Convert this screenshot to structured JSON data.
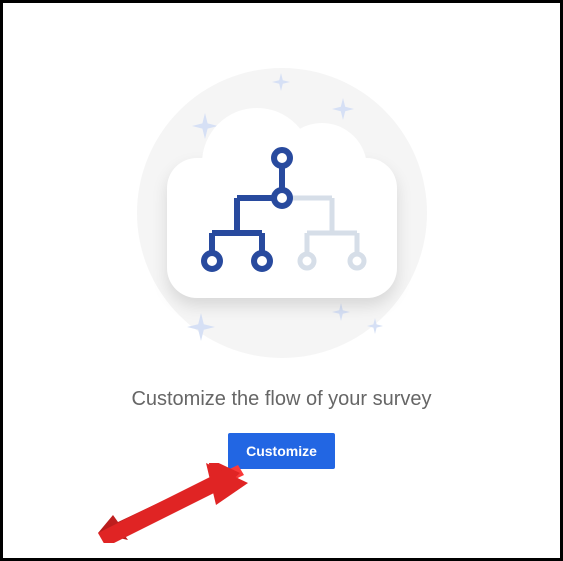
{
  "heading": "Customize the flow of your survey",
  "button_label": "Customize",
  "colors": {
    "accent": "#2266e3",
    "heading": "#666666",
    "sparkle": "#d6e0f5",
    "tree_primary": "#284a9e",
    "tree_secondary": "#d6dee8",
    "arrow": "#e02424"
  }
}
